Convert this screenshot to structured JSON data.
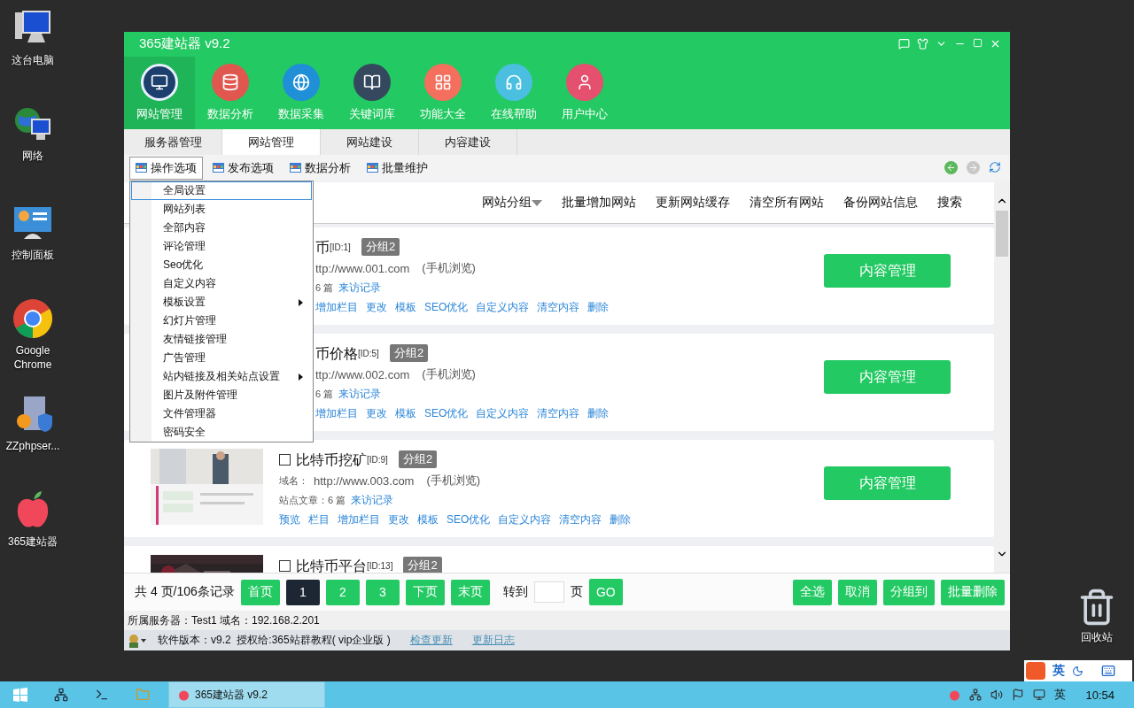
{
  "desktop_icons": [
    {
      "label": "这台电脑",
      "kind": "computer"
    },
    {
      "label": "网络",
      "kind": "network"
    },
    {
      "label": "控制面板",
      "kind": "panel"
    },
    {
      "label": "Google Chrome",
      "kind": "chrome"
    },
    {
      "label": "ZZphpser...",
      "kind": "server"
    },
    {
      "label": "365建站器",
      "kind": "apple"
    }
  ],
  "recycle_bin": {
    "label": "回收站"
  },
  "window": {
    "title": "365建站器 v9.2"
  },
  "nav": [
    {
      "label": "网站管理",
      "selected": true,
      "color": "#1c3f6e",
      "kind": "monitor"
    },
    {
      "label": "数据分析",
      "selected": false,
      "color": "#e0574f",
      "kind": "database"
    },
    {
      "label": "数据采集",
      "selected": false,
      "color": "#1f8fd8",
      "kind": "globe"
    },
    {
      "label": "关键词库",
      "selected": false,
      "color": "#34495e",
      "kind": "book"
    },
    {
      "label": "功能大全",
      "selected": false,
      "color": "#f46f5e",
      "kind": "grid"
    },
    {
      "label": "在线帮助",
      "selected": false,
      "color": "#4bbfe0",
      "kind": "headset"
    },
    {
      "label": "用户中心",
      "selected": false,
      "color": "#e5506e",
      "kind": "user"
    }
  ],
  "tabs": [
    {
      "label": "服务器管理",
      "selected": false
    },
    {
      "label": "网站管理",
      "selected": true
    },
    {
      "label": "网站建设",
      "selected": false
    },
    {
      "label": "内容建设",
      "selected": false
    }
  ],
  "toolbar": [
    {
      "label": "操作选项",
      "selected": true
    },
    {
      "label": "发布选项",
      "selected": false
    },
    {
      "label": "数据分析",
      "selected": false
    },
    {
      "label": "批量维护",
      "selected": false
    }
  ],
  "nav_buttons": [
    {
      "kind": "back",
      "disabled": false
    },
    {
      "kind": "forward",
      "disabled": true
    },
    {
      "kind": "refresh",
      "disabled": false
    }
  ],
  "menu": [
    {
      "label": "全局设置",
      "selected": true,
      "submenu": false
    },
    {
      "label": "网站列表",
      "selected": false,
      "submenu": false
    },
    {
      "label": "全部内容",
      "selected": false,
      "submenu": false
    },
    {
      "label": "评论管理",
      "selected": false,
      "submenu": false
    },
    {
      "label": "Seo优化",
      "selected": false,
      "submenu": false
    },
    {
      "label": "自定义内容",
      "selected": false,
      "submenu": false
    },
    {
      "label": "模板设置",
      "selected": false,
      "submenu": true
    },
    {
      "label": "幻灯片管理",
      "selected": false,
      "submenu": false
    },
    {
      "label": "友情链接管理",
      "selected": false,
      "submenu": false
    },
    {
      "label": "广告管理",
      "selected": false,
      "submenu": false
    },
    {
      "label": "站内链接及相关站点设置",
      "selected": false,
      "submenu": true
    },
    {
      "label": "图片及附件管理",
      "selected": false,
      "submenu": false
    },
    {
      "label": "文件管理器",
      "selected": false,
      "submenu": false
    },
    {
      "label": "密码安全",
      "selected": false,
      "submenu": false
    }
  ],
  "header_actions": [
    {
      "label": "网站分组",
      "dropdown": true
    },
    {
      "label": "批量增加网站",
      "dropdown": false
    },
    {
      "label": "更新网站缓存",
      "dropdown": false
    },
    {
      "label": "清空所有网站",
      "dropdown": false
    },
    {
      "label": "备份网站信息",
      "dropdown": false
    },
    {
      "label": "搜索",
      "dropdown": false
    }
  ],
  "sites": [
    {
      "kind": "covered",
      "title": "币",
      "id": "[ID:1]",
      "tag": "分组2",
      "domain": "ttp://www.001.com",
      "mobile": "(手机浏览)",
      "stats": "6 篇",
      "visits": "来访记录",
      "links": [
        "增加栏目",
        "更改",
        "模板",
        "SEO优化",
        "自定义内容",
        "清空内容",
        "删除"
      ],
      "button": "内容管理"
    },
    {
      "kind": "covered",
      "title": "币价格",
      "id": "[ID:5]",
      "tag": "分组2",
      "domain": "ttp://www.002.com",
      "mobile": "(手机浏览)",
      "stats": "6 篇",
      "visits": "来访记录",
      "links": [
        "增加栏目",
        "更改",
        "模板",
        "SEO优化",
        "自定义内容",
        "清空内容",
        "删除"
      ],
      "button": "内容管理"
    },
    {
      "kind": "full",
      "checked": false,
      "title": "比特币挖矿",
      "id": "[ID:9]",
      "tag": "分组2",
      "domain_label": "域名：",
      "domain": "http://www.003.com",
      "mobile": "(手机浏览)",
      "stats": "站点文章：6 篇",
      "visits": "来访记录",
      "links": [
        "预览",
        "栏目",
        "增加栏目",
        "更改",
        "模板",
        "SEO优化",
        "自定义内容",
        "清空内容",
        "删除"
      ],
      "button": "内容管理"
    },
    {
      "kind": "full",
      "checked": false,
      "title": "比特币平台",
      "id": "[ID:13]",
      "tag": "分组2"
    }
  ],
  "pager": {
    "summary": "共 4 页/106条记录",
    "buttons": [
      {
        "label": "首页",
        "selected": false
      },
      {
        "label": "1",
        "selected": true
      },
      {
        "label": "2",
        "selected": false
      },
      {
        "label": "3",
        "selected": false
      },
      {
        "label": "下页",
        "selected": false
      },
      {
        "label": "末页",
        "selected": false
      }
    ],
    "goto_label": "转到",
    "page_label": "页",
    "go": "GO",
    "actions": [
      "全选",
      "取消",
      "分组到",
      "批量删除"
    ]
  },
  "status": "所属服务器：Test1 域名：192.168.2.201",
  "footer": {
    "version": "软件版本：v9.2  授权给:365站群教程( vip企业版 )",
    "links": [
      "检查更新",
      "更新日志"
    ]
  },
  "ime": {
    "label": "英"
  },
  "taskbar": {
    "app": "365建站器 v9.2",
    "lang": "英",
    "time": "10:54"
  }
}
